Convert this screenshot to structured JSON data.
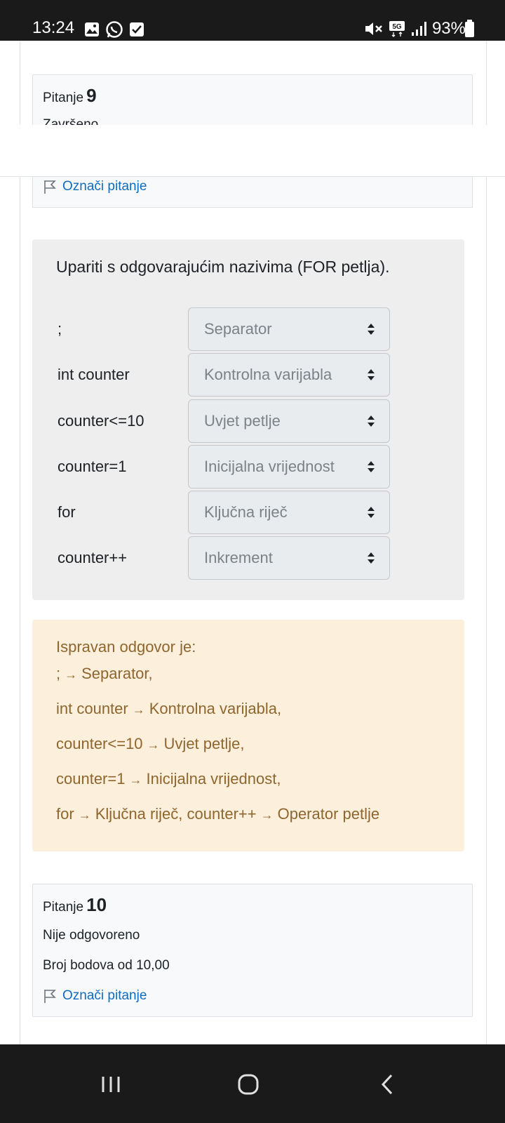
{
  "status_bar": {
    "time": "13:24",
    "battery": "93%",
    "network": "5G"
  },
  "question9": {
    "label": "Pitanje",
    "number": "9",
    "status": "Završeno",
    "flag": "Označi pitanje"
  },
  "question_text": "Upariti s odgovarajućim nazivima (FOR petlja).",
  "matches": [
    {
      "stem": ";",
      "answer": "Separator"
    },
    {
      "stem": "int counter",
      "answer": "Kontrolna varijabla"
    },
    {
      "stem": "counter<=10",
      "answer": "Uvjet petlje"
    },
    {
      "stem": "counter=1",
      "answer": "Inicijalna vrijednost"
    },
    {
      "stem": "for",
      "answer": "Ključna riječ"
    },
    {
      "stem": "counter++",
      "answer": "Inkrement"
    }
  ],
  "feedback": {
    "heading": "Ispravan odgovor je:",
    "arrow": "→",
    "l1_a": ";",
    "l1_b": "Separator,",
    "l2_a": "int counter",
    "l2_b": "Kontrolna varijabla,",
    "l3_a": "counter<=10",
    "l3_b": "Uvjet petlje,",
    "l4_a": "counter=1",
    "l4_b": "Inicijalna vrijednost,",
    "l5_a": "for",
    "l5_b": "Ključna riječ, counter++",
    "l5_c": "Operator petlje"
  },
  "question10": {
    "label": "Pitanje",
    "number": "10",
    "status": "Nije odgovoreno",
    "points": "Broj bodova od 10,00",
    "flag": "Označi pitanje"
  },
  "colors": {
    "link": "#0f6cbf",
    "feedback_bg": "#fcefdc",
    "feedback_text": "#8e662e",
    "question_bg": "#eeeeef"
  }
}
